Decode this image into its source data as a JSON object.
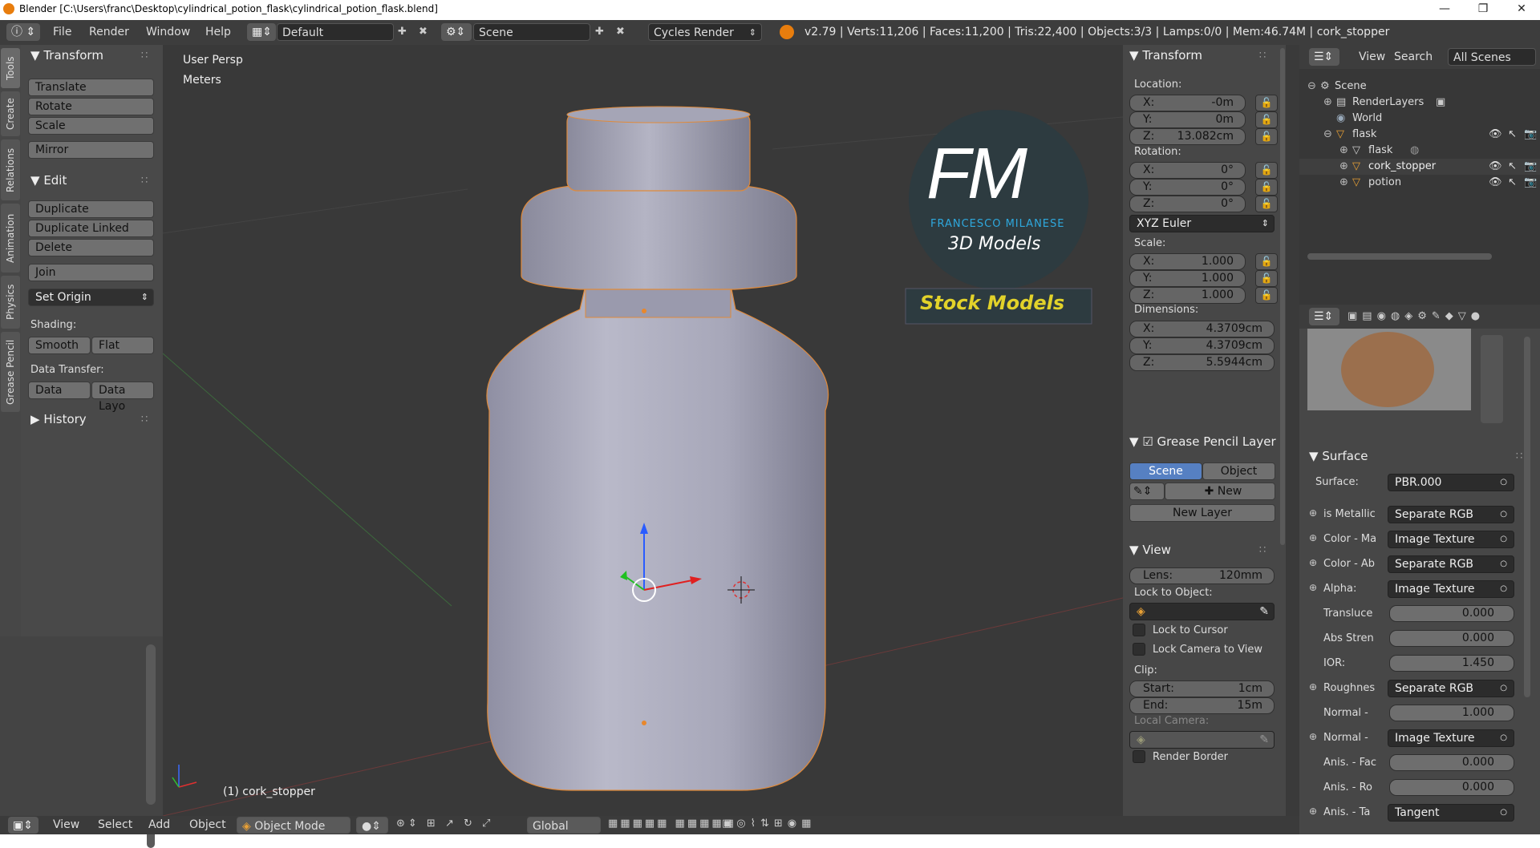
{
  "title": "Blender [C:\\Users\\franc\\Desktop\\cylindrical_potion_flask\\cylindrical_potion_flask.blend]",
  "menu": [
    "File",
    "Render",
    "Window",
    "Help"
  ],
  "layout": "Default",
  "scene": "Scene",
  "engine": "Cycles Render",
  "stats": "v2.79 | Verts:11,206 | Faces:11,200 | Tris:22,400 | Objects:3/3 | Lamps:0/0 | Mem:46.74M | cork_stopper",
  "left_tabs": [
    "Tools",
    "Create",
    "Relations",
    "Animation",
    "Physics",
    "Grease Pencil"
  ],
  "tools": {
    "transform_title": "Transform",
    "translate": "Translate",
    "rotate": "Rotate",
    "scale": "Scale",
    "mirror": "Mirror",
    "edit_title": "Edit",
    "duplicate": "Duplicate",
    "duplicate_linked": "Duplicate Linked",
    "delete": "Delete",
    "join": "Join",
    "set_origin": "Set Origin",
    "shading": "Shading:",
    "smooth": "Smooth",
    "flat": "Flat",
    "data_transfer": "Data Transfer:",
    "data": "Data",
    "data_layo": "Data Layo",
    "history": "History"
  },
  "viewport": {
    "persp": "User Persp",
    "units": "Meters",
    "selected": "(1) cork_stopper"
  },
  "watermark": {
    "fm": "FM",
    "author": "FRANCESCO MILANESE",
    "models": "3D Models",
    "stock": "Stock Models"
  },
  "npanel": {
    "transform": "Transform",
    "location": "Location:",
    "loc": [
      [
        "X:",
        "-0m"
      ],
      [
        "Y:",
        "0m"
      ],
      [
        "Z:",
        "13.082cm"
      ]
    ],
    "rotation": "Rotation:",
    "rot": [
      [
        "X:",
        "0°"
      ],
      [
        "Y:",
        "0°"
      ],
      [
        "Z:",
        "0°"
      ]
    ],
    "rotmode": "XYZ Euler",
    "scale": "Scale:",
    "scl": [
      [
        "X:",
        "1.000"
      ],
      [
        "Y:",
        "1.000"
      ],
      [
        "Z:",
        "1.000"
      ]
    ],
    "dimensions": "Dimensions:",
    "dim": [
      [
        "X:",
        "4.3709cm"
      ],
      [
        "Y:",
        "4.3709cm"
      ],
      [
        "Z:",
        "5.5944cm"
      ]
    ],
    "gp_layer": "Grease Pencil Layer",
    "scene_btn": "Scene",
    "object_btn": "Object",
    "new_btn": "New",
    "new_layer": "New Layer",
    "view": "View",
    "lens_k": "Lens:",
    "lens_v": "120mm",
    "lock_obj": "Lock to Object:",
    "lock_cursor": "Lock to Cursor",
    "lock_camera": "Lock Camera to View",
    "clip": "Clip:",
    "start_k": "Start:",
    "start_v": "1cm",
    "end_k": "End:",
    "end_v": "15m",
    "local_camera": "Local Camera:",
    "render_border": "Render Border"
  },
  "outliner": {
    "view": "View",
    "search": "Search",
    "filter": "All Scenes",
    "items": [
      "Scene",
      "RenderLayers",
      "World",
      "flask",
      "flask",
      "cork_stopper",
      "potion"
    ]
  },
  "props": {
    "surface_title": "Surface",
    "surface_k": "Surface:",
    "surface_v": "PBR.000",
    "rows": [
      {
        "k": "is Metallic",
        "v": "Separate RGB",
        "type": "link"
      },
      {
        "k": "Color - Ma",
        "v": "Image Texture",
        "type": "link"
      },
      {
        "k": "Color - Ab",
        "v": "Separate RGB",
        "type": "link"
      },
      {
        "k": "Alpha:",
        "v": "Image Texture",
        "type": "link"
      },
      {
        "k": "Transluce",
        "v": "0.000",
        "type": "num"
      },
      {
        "k": "Abs Stren",
        "v": "0.000",
        "type": "num"
      },
      {
        "k": "IOR:",
        "v": "1.450",
        "type": "num"
      },
      {
        "k": "Roughnes",
        "v": "Separate RGB",
        "type": "link"
      },
      {
        "k": "Normal -",
        "v": "1.000",
        "type": "num"
      },
      {
        "k": "Normal -",
        "v": "Image Texture",
        "type": "link"
      },
      {
        "k": "Anis. - Fac",
        "v": "0.000",
        "type": "num"
      },
      {
        "k": "Anis. - Ro",
        "v": "0.000",
        "type": "num"
      },
      {
        "k": "Anis. - Ta",
        "v": "Tangent",
        "type": "link"
      }
    ]
  },
  "bottom": {
    "view": "View",
    "select": "Select",
    "add": "Add",
    "object": "Object",
    "mode": "Object Mode",
    "orientation": "Global"
  }
}
